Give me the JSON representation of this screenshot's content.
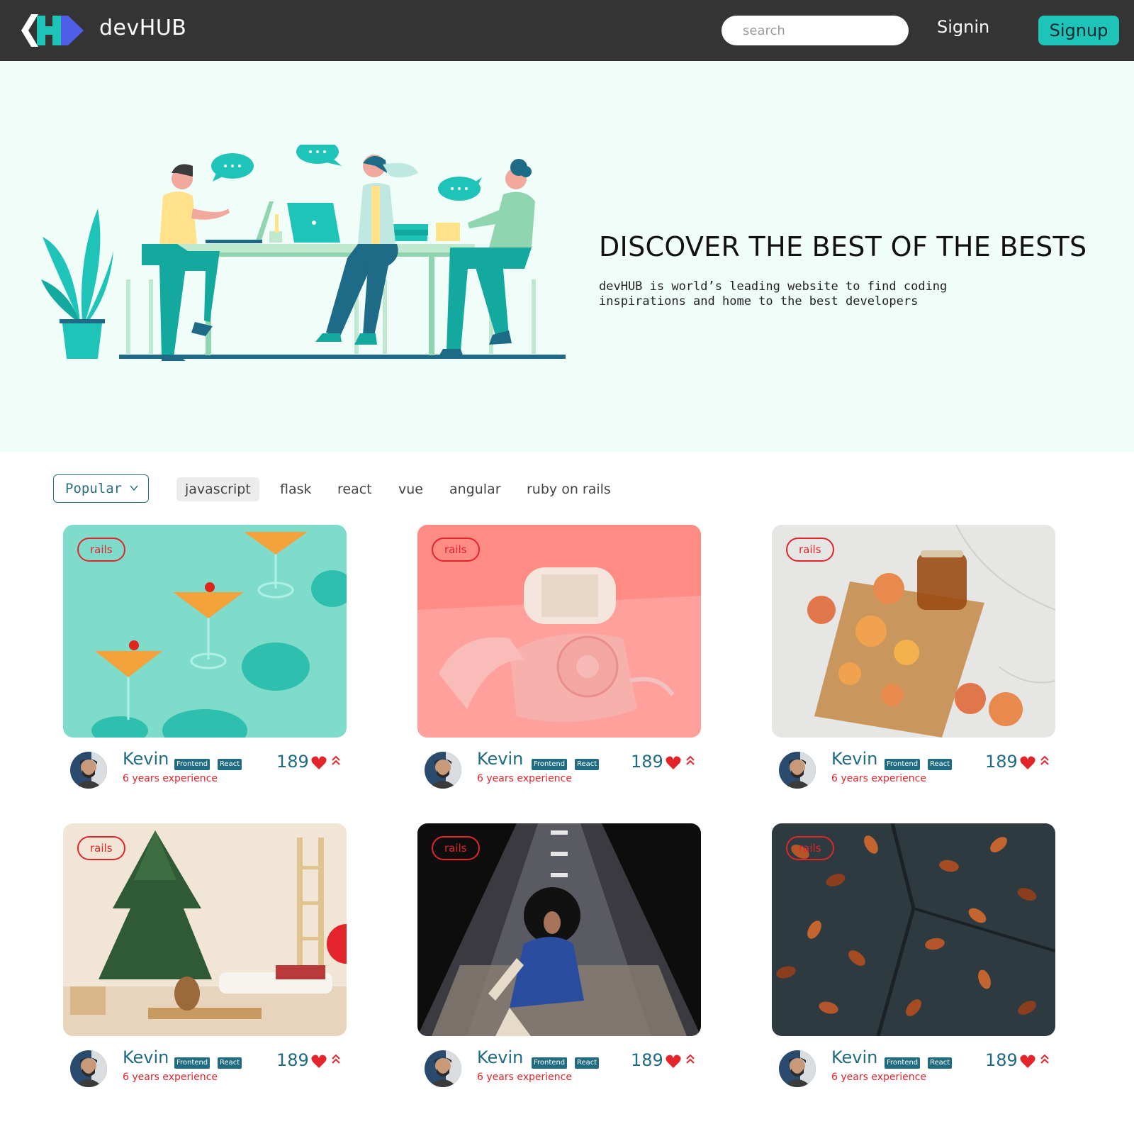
{
  "header": {
    "brand": "devHUB",
    "search_placeholder": "search",
    "signin_label": "Signin",
    "signup_label": "Signup"
  },
  "hero": {
    "title": "DISCOVER THE BEST OF THE BESTS",
    "subtitle": "devHUB is world’s leading website to find coding inspirations and home to the best developers"
  },
  "filters": {
    "sort_selected": "Popular",
    "tags": [
      "javascript",
      "flask",
      "react",
      "vue",
      "angular",
      "ruby on rails"
    ],
    "active_tag": "javascript"
  },
  "cards": [
    {
      "badge": "rails",
      "image": "cocktails-on-teal",
      "author": "Kevin",
      "chips": [
        "Frontend",
        "React"
      ],
      "experience": "6 years experience",
      "likes": "189"
    },
    {
      "badge": "rails",
      "image": "pink-rotary-phone",
      "author": "Kevin",
      "chips": [
        "Frontend",
        "React"
      ],
      "experience": "6 years experience",
      "likes": "189"
    },
    {
      "badge": "rails",
      "image": "peaches-on-cutting-board",
      "author": "Kevin",
      "chips": [
        "Frontend",
        "React"
      ],
      "experience": "6 years experience",
      "likes": "189"
    },
    {
      "badge": "rails",
      "image": "christmas-tree-room",
      "author": "Kevin",
      "chips": [
        "Frontend",
        "React"
      ],
      "experience": "6 years experience",
      "likes": "189"
    },
    {
      "badge": "rails",
      "image": "dancer-on-tiles",
      "author": "Kevin",
      "chips": [
        "Frontend",
        "React"
      ],
      "experience": "6 years experience",
      "likes": "189"
    },
    {
      "badge": "rails",
      "image": "autumn-leaves",
      "author": "Kevin",
      "chips": [
        "Frontend",
        "React"
      ],
      "experience": "6 years experience",
      "likes": "189"
    }
  ],
  "colors": {
    "header_bg": "#343434",
    "accent": "#1fc4b9",
    "hero_bg": "#f1fdf8",
    "name_blue": "#1e6b82",
    "badge_red": "#e3242b"
  }
}
